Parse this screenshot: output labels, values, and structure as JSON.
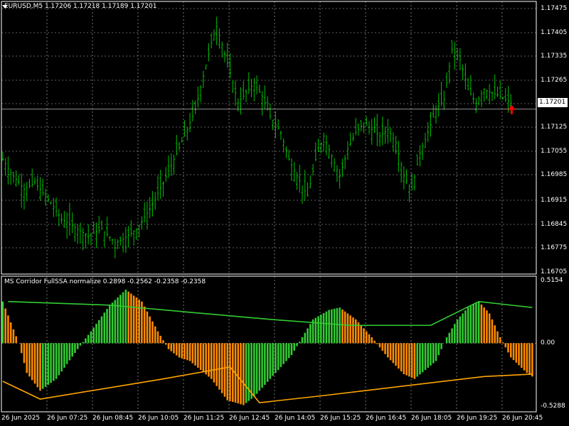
{
  "header": {
    "symbol_info": "EURUSD,M5  1.17206 1.17218 1.17189 1.17201"
  },
  "price_axis": {
    "ticks": [
      "1.17475",
      "1.17405",
      "1.17335",
      "1.17265",
      "1.17201",
      "1.17125",
      "1.17055",
      "1.16985",
      "1.16915",
      "1.16845",
      "1.16775",
      "1.16705"
    ],
    "last_price": "1.17201"
  },
  "indicator": {
    "title": "MS Corridor FullSSA normalize 0.2898 -0.2562 -0.2358 -0.2358",
    "ticks": [
      "0.5154",
      "0.00",
      "-0.5288"
    ]
  },
  "time_axis": {
    "ticks": [
      "26 Jun 2025",
      "26 Jun 07:25",
      "26 Jun 08:45",
      "26 Jun 10:05",
      "26 Jun 11:25",
      "26 Jun 12:45",
      "26 Jun 14:05",
      "26 Jun 15:25",
      "26 Jun 16:45",
      "26 Jun 18:05",
      "26 Jun 19:25",
      "26 Jun 20:45"
    ]
  },
  "colors": {
    "background": "#000000",
    "grid": "#c0c0c0",
    "bar": "#00c000",
    "histogram_up": "#32cd32",
    "histogram_down": "#ff8c00",
    "upper_line": "#32cd32",
    "lower_line": "#ffa500",
    "arrow": "#ff0000"
  },
  "chart_data": [
    {
      "type": "ohlc",
      "title": "EURUSD,M5",
      "ylim": [
        1.16705,
        1.17525
      ],
      "close_path": [
        [
          1.1705,
          0
        ],
        [
          1.1701,
          3
        ],
        [
          1.1696,
          8
        ],
        [
          1.1698,
          12
        ],
        [
          1.1692,
          18
        ],
        [
          1.1687,
          22
        ],
        [
          1.1684,
          28
        ],
        [
          1.1682,
          32
        ],
        [
          1.1684,
          37
        ],
        [
          1.168,
          42
        ],
        [
          1.1681,
          45
        ],
        [
          1.1684,
          50
        ],
        [
          1.169,
          55
        ],
        [
          1.1698,
          60
        ],
        [
          1.1705,
          64
        ],
        [
          1.1712,
          68
        ],
        [
          1.172,
          72
        ],
        [
          1.173,
          75
        ],
        [
          1.174,
          78
        ],
        [
          1.1745,
          80
        ],
        [
          1.1734,
          84
        ],
        [
          1.1722,
          88
        ],
        [
          1.1725,
          91
        ],
        [
          1.1728,
          94
        ],
        [
          1.1724,
          97
        ],
        [
          1.1718,
          100
        ],
        [
          1.1713,
          104
        ],
        [
          1.1705,
          107
        ],
        [
          1.17,
          110
        ],
        [
          1.1694,
          114
        ],
        [
          1.1705,
          117
        ],
        [
          1.1712,
          120
        ],
        [
          1.1706,
          123
        ],
        [
          1.17,
          126
        ],
        [
          1.1708,
          129
        ],
        [
          1.1713,
          132
        ],
        [
          1.1716,
          135
        ],
        [
          1.1714,
          138
        ],
        [
          1.1712,
          141
        ],
        [
          1.1714,
          144
        ],
        [
          1.171,
          147
        ],
        [
          1.17,
          150
        ],
        [
          1.1696,
          153
        ],
        [
          1.1707,
          156
        ],
        [
          1.1713,
          159
        ],
        [
          1.172,
          162
        ],
        [
          1.1723,
          165
        ],
        [
          1.1738,
          168
        ],
        [
          1.1735,
          171
        ],
        [
          1.1726,
          174
        ],
        [
          1.1722,
          177
        ],
        [
          1.1726,
          180
        ],
        [
          1.1725,
          183
        ],
        [
          1.1724,
          186
        ],
        [
          1.1722,
          190
        ]
      ],
      "series": [
        {
          "name": "EURUSD,M5"
        }
      ]
    },
    {
      "type": "bar",
      "title": "MS Corridor FullSSA normalize",
      "ylim": [
        -0.5288,
        0.5154
      ],
      "wave": [
        [
          0.35,
          0
        ],
        [
          0.0,
          6
        ],
        [
          -0.25,
          9
        ],
        [
          -0.4,
          14
        ],
        [
          -0.3,
          20
        ],
        [
          -0.05,
          28
        ],
        [
          0.1,
          33
        ],
        [
          0.32,
          40
        ],
        [
          0.45,
          46
        ],
        [
          0.35,
          52
        ],
        [
          0.1,
          58
        ],
        [
          -0.05,
          62
        ],
        [
          -0.12,
          66
        ],
        [
          -0.15,
          70
        ],
        [
          -0.3,
          78
        ],
        [
          -0.48,
          84
        ],
        [
          -0.52,
          90
        ],
        [
          -0.45,
          94
        ],
        [
          -0.3,
          100
        ],
        [
          -0.1,
          108
        ],
        [
          0.05,
          112
        ],
        [
          0.2,
          116
        ],
        [
          0.28,
          122
        ],
        [
          0.3,
          126
        ],
        [
          0.2,
          132
        ],
        [
          0.05,
          138
        ],
        [
          -0.12,
          144
        ],
        [
          -0.26,
          150
        ],
        [
          -0.3,
          154
        ],
        [
          -0.15,
          162
        ],
        [
          0.05,
          166
        ],
        [
          0.2,
          170
        ],
        [
          0.3,
          174
        ],
        [
          0.35,
          178
        ],
        [
          0.25,
          182
        ],
        [
          0.05,
          186
        ],
        [
          -0.12,
          190
        ],
        [
          -0.25,
          196
        ],
        [
          -0.28,
          198
        ]
      ],
      "upper_line": [
        [
          0.35,
          2
        ],
        [
          0.32,
          40
        ],
        [
          0.2,
          100
        ],
        [
          0.15,
          130
        ],
        [
          0.15,
          160
        ],
        [
          0.35,
          178
        ],
        [
          0.32,
          190
        ],
        [
          0.3,
          198
        ]
      ],
      "lower_line": [
        [
          -0.32,
          0
        ],
        [
          -0.47,
          14
        ],
        [
          -0.3,
          60
        ],
        [
          -0.2,
          85
        ],
        [
          -0.5,
          96
        ],
        [
          -0.44,
          120
        ],
        [
          -0.28,
          180
        ],
        [
          -0.26,
          198
        ]
      ],
      "series": [
        {
          "name": "MS Corridor FullSSA normalize"
        }
      ]
    }
  ]
}
